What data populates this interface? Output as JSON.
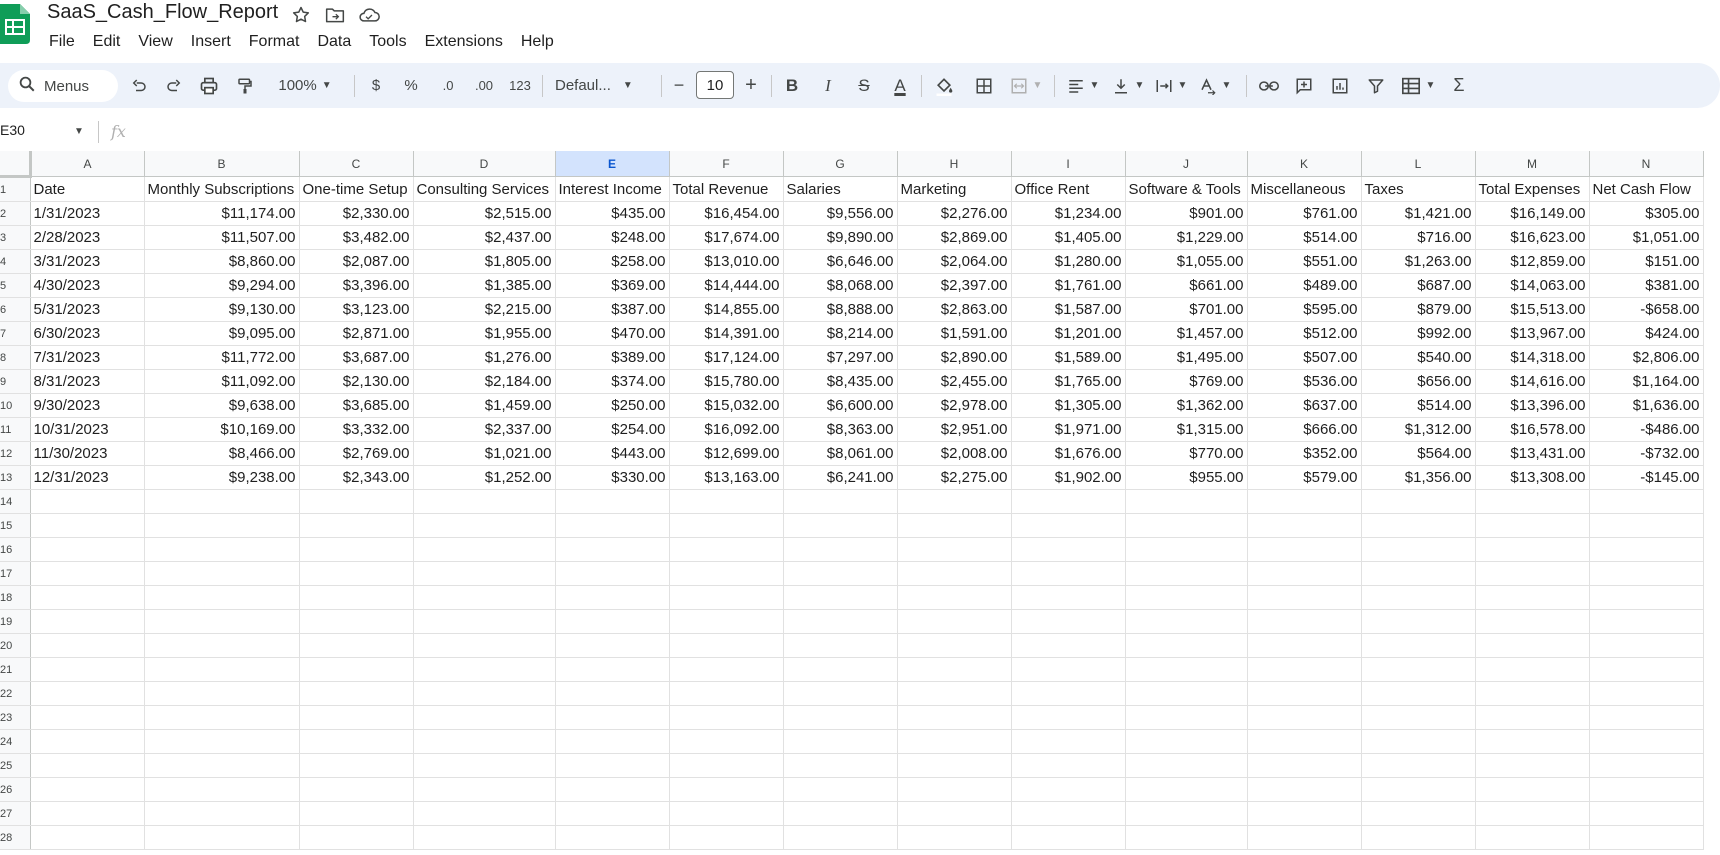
{
  "app": {
    "doc_title": "SaaS_Cash_Flow_Report",
    "menu": [
      "File",
      "Edit",
      "View",
      "Insert",
      "Format",
      "Data",
      "Tools",
      "Extensions",
      "Help"
    ],
    "accent": "#0b57d0",
    "sheets_green": "#0f9d58"
  },
  "toolbar": {
    "search_label": "Menus",
    "zoom": "100%",
    "currency": "$",
    "percent": "%",
    "decrease_decimal": ".0",
    "increase_decimal": ".00",
    "number_format": "123",
    "font": "Defaul...",
    "minus": "−",
    "font_size": "10",
    "plus": "+",
    "bold": "B",
    "italic": "I",
    "strike": "S",
    "text_color": "A",
    "sum": "Σ"
  },
  "formula_bar": {
    "name_box": "E30",
    "fx": "fx"
  },
  "grid": {
    "selected_column": "E",
    "columns": [
      "A",
      "B",
      "C",
      "D",
      "E",
      "F",
      "G",
      "H",
      "I",
      "J",
      "K",
      "L",
      "M",
      "N"
    ],
    "headers": [
      "Date",
      "Monthly Subscriptions",
      "One-time Setup",
      "Consulting Services",
      "Interest Income",
      "Total Revenue",
      "Salaries",
      "Marketing",
      "Office Rent",
      "Software & Tools",
      "Miscellaneous",
      "Taxes",
      "Total Expenses",
      "Net Cash Flow"
    ],
    "rows": [
      [
        "1/31/2023",
        "$11,174.00",
        "$2,330.00",
        "$2,515.00",
        "$435.00",
        "$16,454.00",
        "$9,556.00",
        "$2,276.00",
        "$1,234.00",
        "$901.00",
        "$761.00",
        "$1,421.00",
        "$16,149.00",
        "$305.00"
      ],
      [
        "2/28/2023",
        "$11,507.00",
        "$3,482.00",
        "$2,437.00",
        "$248.00",
        "$17,674.00",
        "$9,890.00",
        "$2,869.00",
        "$1,405.00",
        "$1,229.00",
        "$514.00",
        "$716.00",
        "$16,623.00",
        "$1,051.00"
      ],
      [
        "3/31/2023",
        "$8,860.00",
        "$2,087.00",
        "$1,805.00",
        "$258.00",
        "$13,010.00",
        "$6,646.00",
        "$2,064.00",
        "$1,280.00",
        "$1,055.00",
        "$551.00",
        "$1,263.00",
        "$12,859.00",
        "$151.00"
      ],
      [
        "4/30/2023",
        "$9,294.00",
        "$3,396.00",
        "$1,385.00",
        "$369.00",
        "$14,444.00",
        "$8,068.00",
        "$2,397.00",
        "$1,761.00",
        "$661.00",
        "$489.00",
        "$687.00",
        "$14,063.00",
        "$381.00"
      ],
      [
        "5/31/2023",
        "$9,130.00",
        "$3,123.00",
        "$2,215.00",
        "$387.00",
        "$14,855.00",
        "$8,888.00",
        "$2,863.00",
        "$1,587.00",
        "$701.00",
        "$595.00",
        "$879.00",
        "$15,513.00",
        "-$658.00"
      ],
      [
        "6/30/2023",
        "$9,095.00",
        "$2,871.00",
        "$1,955.00",
        "$470.00",
        "$14,391.00",
        "$8,214.00",
        "$1,591.00",
        "$1,201.00",
        "$1,457.00",
        "$512.00",
        "$992.00",
        "$13,967.00",
        "$424.00"
      ],
      [
        "7/31/2023",
        "$11,772.00",
        "$3,687.00",
        "$1,276.00",
        "$389.00",
        "$17,124.00",
        "$7,297.00",
        "$2,890.00",
        "$1,589.00",
        "$1,495.00",
        "$507.00",
        "$540.00",
        "$14,318.00",
        "$2,806.00"
      ],
      [
        "8/31/2023",
        "$11,092.00",
        "$2,130.00",
        "$2,184.00",
        "$374.00",
        "$15,780.00",
        "$8,435.00",
        "$2,455.00",
        "$1,765.00",
        "$769.00",
        "$536.00",
        "$656.00",
        "$14,616.00",
        "$1,164.00"
      ],
      [
        "9/30/2023",
        "$9,638.00",
        "$3,685.00",
        "$1,459.00",
        "$250.00",
        "$15,032.00",
        "$6,600.00",
        "$2,978.00",
        "$1,305.00",
        "$1,362.00",
        "$637.00",
        "$514.00",
        "$13,396.00",
        "$1,636.00"
      ],
      [
        "10/31/2023",
        "$10,169.00",
        "$3,332.00",
        "$2,337.00",
        "$254.00",
        "$16,092.00",
        "$8,363.00",
        "$2,951.00",
        "$1,971.00",
        "$1,315.00",
        "$666.00",
        "$1,312.00",
        "$16,578.00",
        "-$486.00"
      ],
      [
        "11/30/2023",
        "$8,466.00",
        "$2,769.00",
        "$1,021.00",
        "$443.00",
        "$12,699.00",
        "$8,061.00",
        "$2,008.00",
        "$1,676.00",
        "$770.00",
        "$352.00",
        "$564.00",
        "$13,431.00",
        "-$732.00"
      ],
      [
        "12/31/2023",
        "$9,238.00",
        "$2,343.00",
        "$1,252.00",
        "$330.00",
        "$13,163.00",
        "$6,241.00",
        "$2,275.00",
        "$1,902.00",
        "$955.00",
        "$579.00",
        "$1,356.00",
        "$13,308.00",
        "-$145.00"
      ]
    ],
    "row_numbers": [
      "1",
      "2",
      "3",
      "4",
      "5",
      "6",
      "7",
      "8",
      "9",
      "10",
      "11",
      "12",
      "13",
      "14",
      "15",
      "16",
      "17",
      "18",
      "19",
      "20",
      "21",
      "22",
      "23",
      "24",
      "25",
      "26",
      "27",
      "28"
    ]
  }
}
